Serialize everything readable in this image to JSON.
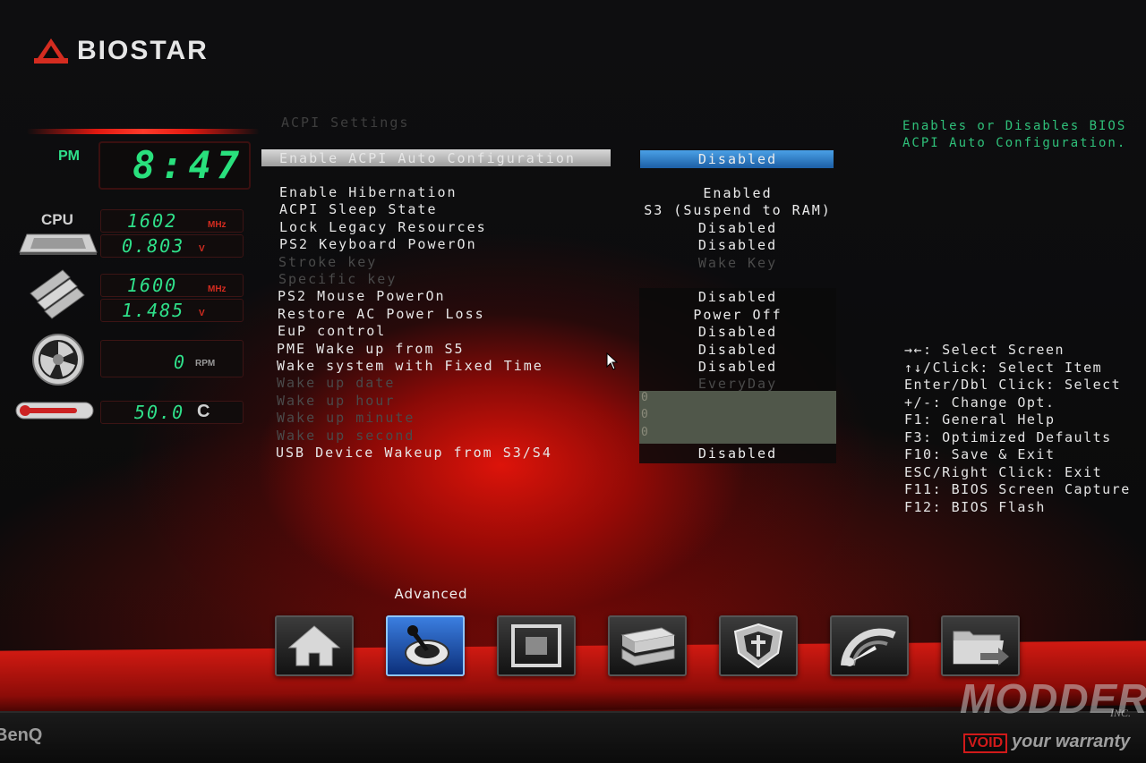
{
  "brand": {
    "name": "BIOSTAR",
    "reg": "®"
  },
  "monitor": {
    "ampm": "PM",
    "time": "8:47",
    "cpu_label": "CPU",
    "cpu_freq": "1602",
    "cpu_freq_unit": "MHz",
    "cpu_volt": "0.803",
    "cpu_volt_unit": "V",
    "mem_freq": "1600",
    "mem_freq_unit": "MHz",
    "mem_volt": "1.485",
    "mem_volt_unit": "V",
    "fan_speed": "0",
    "fan_unit": "RPM",
    "temperature": "50.0",
    "temp_unit": "C"
  },
  "section_title": "ACPI Settings",
  "settings": [
    {
      "label": "Enable ACPI Auto Configuration",
      "value": "Disabled",
      "enabled": true,
      "selected": true
    },
    {
      "label": "Enable Hibernation",
      "value": "Enabled",
      "enabled": true
    },
    {
      "label": "ACPI Sleep State",
      "value": "S3 (Suspend to RAM)",
      "enabled": true
    },
    {
      "label": "Lock Legacy Resources",
      "value": "Disabled",
      "enabled": true
    },
    {
      "label": "PS2 Keyboard PowerOn",
      "value": "Disabled",
      "enabled": true
    },
    {
      "label": "Stroke key",
      "value": "Wake Key",
      "enabled": false
    },
    {
      "label": "Specific key",
      "value": "",
      "enabled": false
    },
    {
      "label": "PS2 Mouse PowerOn",
      "value": "Disabled",
      "enabled": true
    },
    {
      "label": "Restore AC Power Loss",
      "value": "Power Off",
      "enabled": true
    },
    {
      "label": "EuP control",
      "value": "Disabled",
      "enabled": true
    },
    {
      "label": "PME Wake up from S5",
      "value": "Disabled",
      "enabled": true
    },
    {
      "label": "Wake system with Fixed Time",
      "value": "Disabled",
      "enabled": true
    },
    {
      "label": "Wake up date",
      "value": "EveryDay",
      "enabled": false
    },
    {
      "label": "Wake up hour",
      "value": "0",
      "enabled": false
    },
    {
      "label": "Wake up minute",
      "value": "0",
      "enabled": false
    },
    {
      "label": "Wake up second",
      "value": "0",
      "enabled": false
    },
    {
      "label": "USB Device Wakeup from S3/S4",
      "value": "Disabled",
      "enabled": true
    }
  ],
  "help": {
    "description": "Enables or Disables BIOS ACPI Auto Configuration.",
    "keys": [
      "→←: Select Screen",
      "↑↓/Click: Select Item",
      "Enter/Dbl Click: Select",
      "+/-: Change Opt.",
      "F1: General Help",
      "F3: Optimized Defaults",
      "F10: Save & Exit",
      "ESC/Right Click: Exit",
      "F11: BIOS Screen Capture",
      "F12: BIOS Flash"
    ]
  },
  "tabs": {
    "active_caption": "Advanced",
    "items": [
      {
        "icon": "home-icon"
      },
      {
        "icon": "joystick-icon",
        "active": true
      },
      {
        "icon": "chipset-icon"
      },
      {
        "icon": "drives-icon"
      },
      {
        "icon": "shield-icon"
      },
      {
        "icon": "speedometer-icon"
      },
      {
        "icon": "folder-exit-icon"
      }
    ]
  },
  "watermark": {
    "main": "MODDERS",
    "inc": "INC.",
    "void": "VOID",
    "tagline": "your warranty"
  },
  "bezel_brand": "BenQ",
  "colors": {
    "accent_green": "#2fe08a",
    "selected_value": "#2a72c4",
    "brand_red": "#d42c20"
  }
}
